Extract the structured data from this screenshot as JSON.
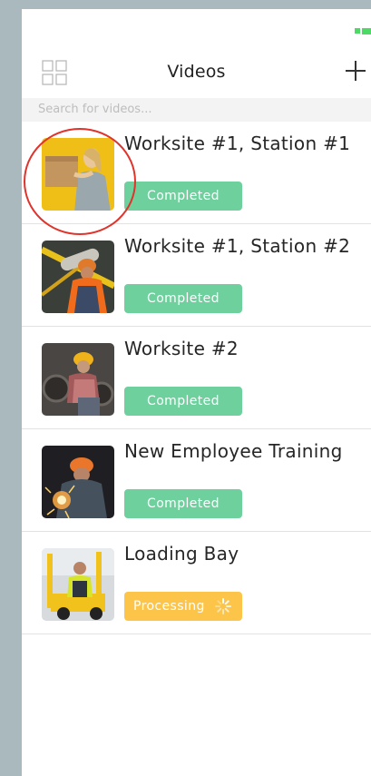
{
  "header": {
    "title": "Videos"
  },
  "search": {
    "placeholder": "Search for videos..."
  },
  "videos": [
    {
      "title": "Worksite #1, Station #1",
      "status": "Completed",
      "thumbnail": "woman-holding-box"
    },
    {
      "title": "Worksite #1, Station #2",
      "status": "Completed",
      "thumbnail": "worker-carrying-pipe"
    },
    {
      "title": "Worksite #2",
      "status": "Completed",
      "thumbnail": "worker-in-hardhat-machinery"
    },
    {
      "title": "New Employee Training",
      "status": "Completed",
      "thumbnail": "welder-sparks"
    },
    {
      "title": "Loading Bay",
      "status": "Processing",
      "thumbnail": "forklift-driver"
    }
  ],
  "colors": {
    "completed": "#6ed09d",
    "processing": "#fcc54a",
    "highlight": "#e0332b",
    "background": "#a9b9bd"
  },
  "icons": [
    "grid-icon",
    "add-icon",
    "battery-icon",
    "loading-spinner-icon"
  ]
}
